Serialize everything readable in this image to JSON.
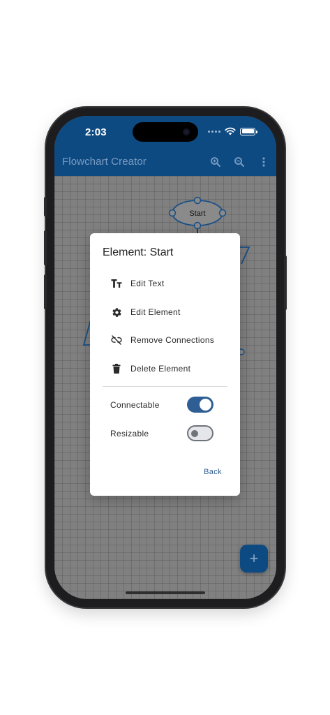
{
  "status_bar": {
    "time": "2:03"
  },
  "app_bar": {
    "title": "Flowchart Creator",
    "icons": [
      "zoom-in-icon",
      "search-icon",
      "more-vert-icon"
    ]
  },
  "canvas": {
    "start_node_label": "Start"
  },
  "dialog": {
    "title": "Element: Start",
    "menu": [
      {
        "label": "Edit Text",
        "icon": "text-format-icon"
      },
      {
        "label": "Edit Element",
        "icon": "gear-icon"
      },
      {
        "label": "Remove Connections",
        "icon": "link-off-icon"
      },
      {
        "label": "Delete Element",
        "icon": "trash-icon"
      }
    ],
    "toggles": [
      {
        "label": "Connectable",
        "on": true
      },
      {
        "label": "Resizable",
        "on": false
      }
    ],
    "back_label": "Back"
  },
  "fab": {
    "label": "+"
  },
  "colors": {
    "app_bar": "#0e4a82",
    "accent": "#2e5e93",
    "canvas": "#808080",
    "dialog_bg": "#ffffff"
  }
}
